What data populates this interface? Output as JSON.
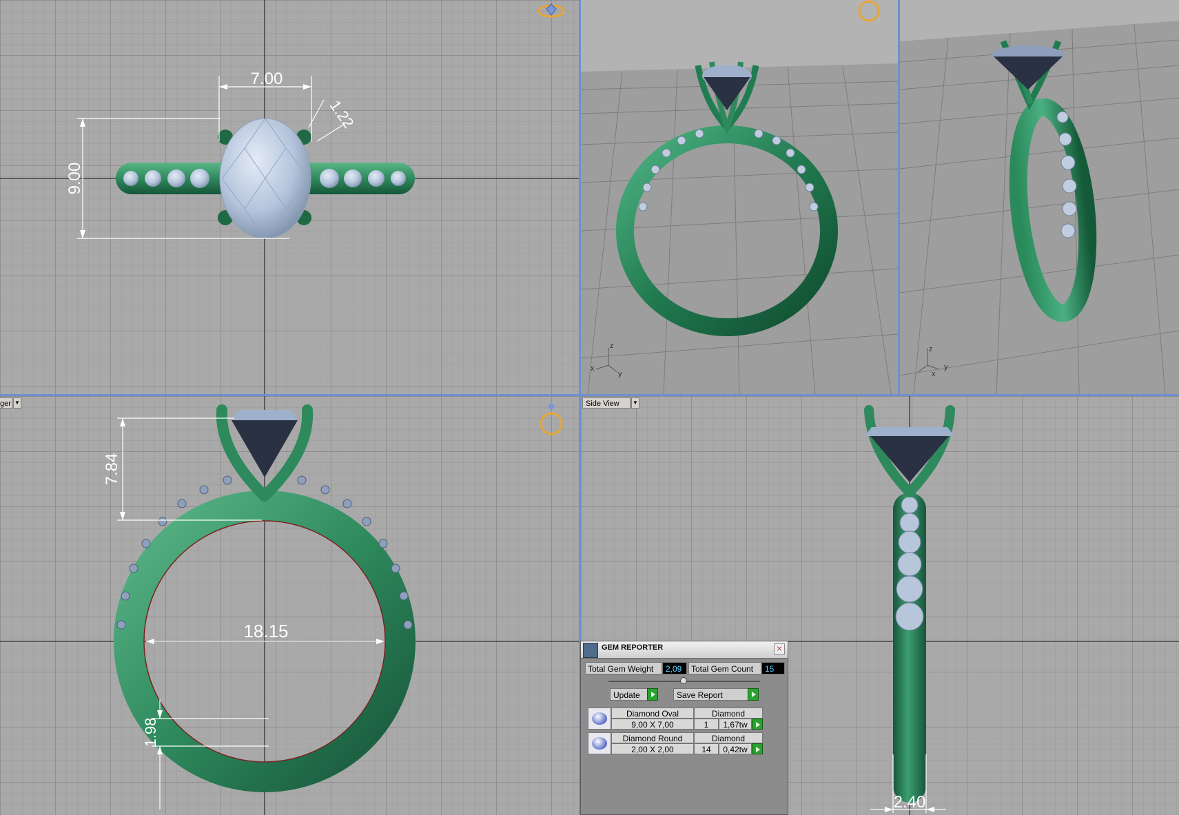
{
  "viewports": {
    "top": {
      "dimensions": {
        "width": "7.00",
        "height": "9.00",
        "prong": "1.22"
      }
    },
    "front": {
      "dimensions": {
        "setting_height": "7.84",
        "inner_diameter": "18.15",
        "band_thickness": "1.98"
      }
    },
    "side": {
      "label": "Side View",
      "dimensions": {
        "band_width": "2.40"
      }
    },
    "left_label_fragment": "ger",
    "axis_labels": {
      "z": "z",
      "x": "x",
      "y": "y"
    }
  },
  "gem_reporter": {
    "title": "GEM REPORTER",
    "total_weight_label": "Total Gem Weight",
    "total_weight_value": "2,09",
    "total_count_label": "Total Gem Count",
    "total_count_value": "15",
    "update_label": "Update",
    "save_label": "Save Report",
    "gems": [
      {
        "name": "Diamond Oval",
        "material": "Diamond",
        "size": "9,00 X 7,00",
        "count": "1",
        "weight": "1,67tw"
      },
      {
        "name": "Diamond Round",
        "material": "Diamond",
        "size": "2,00 X 2,00",
        "count": "14",
        "weight": "0,42tw"
      }
    ]
  },
  "colors": {
    "metal": "#2e8a5c",
    "gem": "#b4c4dc",
    "grid_bg": "#a9a9a9",
    "divider": "#6f8fd0"
  }
}
